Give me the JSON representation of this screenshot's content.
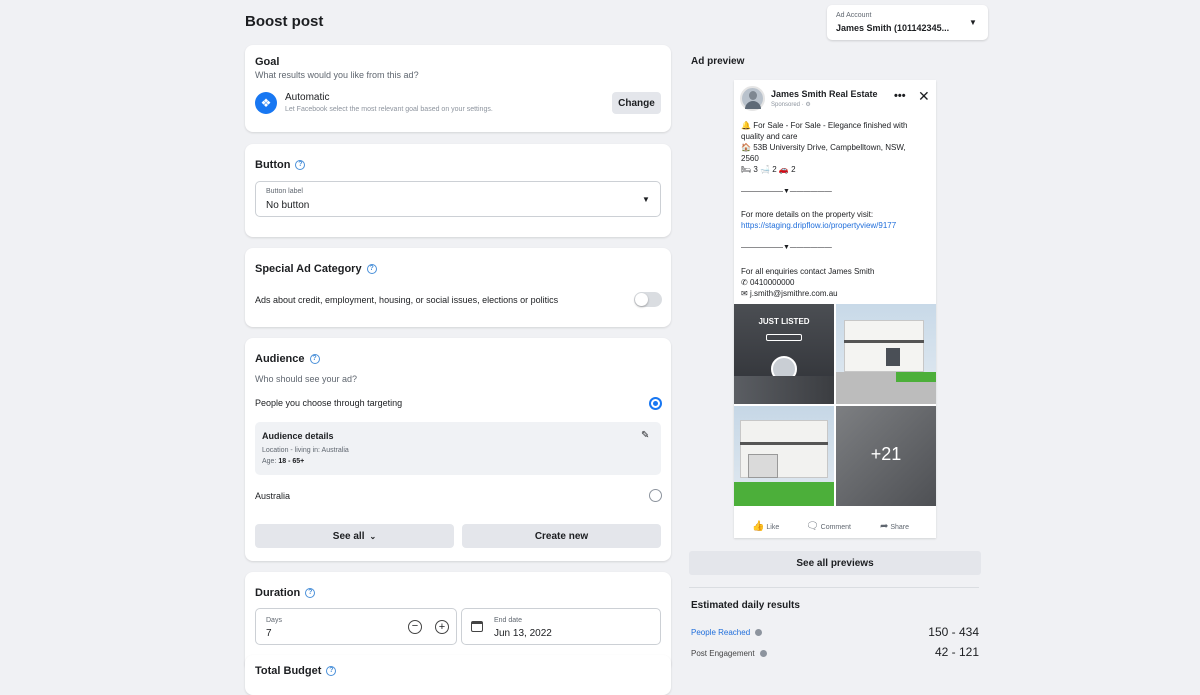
{
  "page_title": "Boost post",
  "ad_account": {
    "label": "Ad Account",
    "value": "James Smith (101142345..."
  },
  "goal": {
    "title": "Goal",
    "subtitle": "What results would you like from this ad?",
    "option": "Automatic",
    "option_desc": "Let Facebook select the most relevant goal based on your settings.",
    "change": "Change"
  },
  "button_section": {
    "title": "Button",
    "field_label": "Button label",
    "value": "No button"
  },
  "special": {
    "title": "Special Ad Category",
    "desc": "Ads about credit, employment, housing, or social issues, elections or politics"
  },
  "audience": {
    "title": "Audience",
    "subtitle": "Who should see your ad?",
    "targeting": "People you choose through targeting",
    "details_title": "Audience details",
    "details_location": "Location - living in: Australia",
    "details_age_label": "Age:",
    "details_age": "18 - 65+",
    "option2": "Australia",
    "see_all": "See all",
    "create_new": "Create new"
  },
  "duration": {
    "title": "Duration",
    "days_label": "Days",
    "days": "7",
    "end_label": "End date",
    "end": "Jun 13, 2022"
  },
  "total_budget": {
    "title": "Total Budget"
  },
  "preview": {
    "title": "Ad preview",
    "page_name": "James Smith Real Estate",
    "sponsored": "Sponsored · ⚙",
    "line1": "For Sale - For Sale - Elegance finished with",
    "line1b": "quality and care",
    "address": "53B University Drive, Campbelltown, NSW,",
    "postcode": "2560",
    "features": "🛏 3 🛁 2 🚗 2",
    "divider": "——————▼——————",
    "more_details": "For more details on the property visit:",
    "link": "https://staging.dripflow.io/propertyview/9177",
    "enquiries": "For all enquiries contact James Smith",
    "phone": "0410000000",
    "email": "j.smith@jsmithre.com.au",
    "just_listed": "JUST LISTED",
    "plus_count": "+21",
    "like": "Like",
    "comment": "Comment",
    "share": "Share",
    "see_all_previews": "See all previews"
  },
  "results": {
    "title": "Estimated daily results",
    "rows": [
      {
        "label": "People Reached",
        "value": "150 - 434"
      },
      {
        "label": "Post Engagement",
        "value": "42 - 121"
      }
    ]
  },
  "colors": {
    "accent": "#1877f2",
    "link": "#216fdb",
    "grass": "#4caf3a"
  }
}
